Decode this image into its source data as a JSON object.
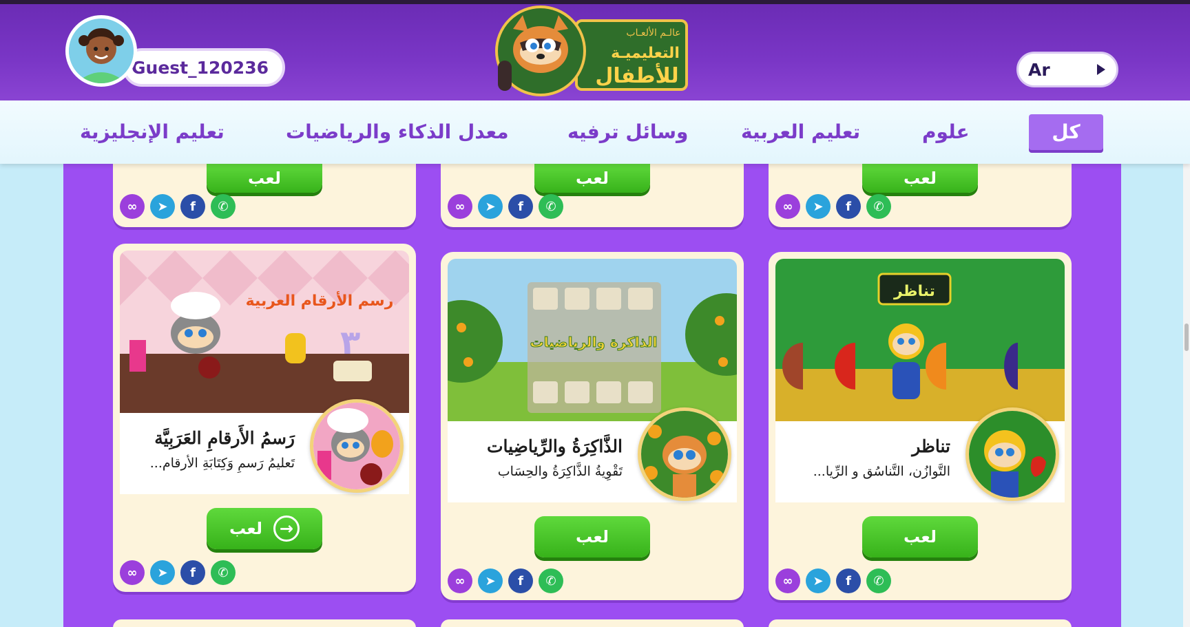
{
  "header": {
    "username": "Guest_120236",
    "logo_text": {
      "line1": "عالـم الألعـاب",
      "line2": "التعليميـة",
      "line3": "للأطفال"
    },
    "language": "Ar"
  },
  "categories": [
    {
      "label": "كل",
      "active": true
    },
    {
      "label": "علوم",
      "active": false
    },
    {
      "label": "تعليم العربية",
      "active": false
    },
    {
      "label": "وسائل ترفيه",
      "active": false
    },
    {
      "label": "معدل الذكاء والرياضيات",
      "active": false
    },
    {
      "label": "تعليم الإنجليزية",
      "active": false
    }
  ],
  "games": [
    {
      "title": "تناظر",
      "description": "التَّوازُن، التَّناسُق و الرِّيا...",
      "image_title": "تناظر",
      "play_label": "لعب"
    },
    {
      "title": "الذَّاكِرَةُ والرِّياضِيات",
      "description": "تَقْوِيةُ الذَّاكِرَةُ والحِسَاب",
      "image_title": "الذاكرة والرياضيات",
      "play_label": "لعب"
    },
    {
      "title": "رَسمُ الأَرقامِ العَرَبِيَّة",
      "description": "تَعليمُ رَسمِ وَكِتَابَةِ الأرقام...",
      "image_title": "رسم الأرقام العربية",
      "play_label": "لعب"
    }
  ],
  "top_row_play_label": "لعب",
  "share_icons": [
    "link-icon",
    "telegram-icon",
    "facebook-icon",
    "whatsapp-icon"
  ],
  "colors": {
    "header_purple": "#7a36c6",
    "grid_purple": "#9c4ef2",
    "play_green": "#3fbf22",
    "card_cream": "#fdf4dc",
    "active_tab": "#a56cf0"
  }
}
